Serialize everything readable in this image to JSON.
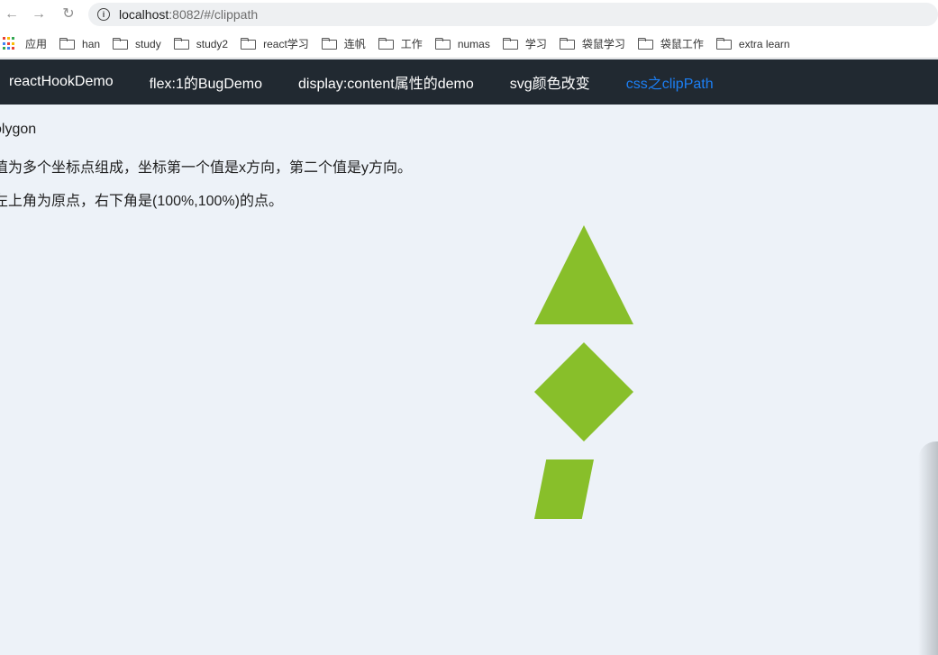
{
  "browser": {
    "url_host": "localhost",
    "url_rest": ":8082/#/clippath",
    "bookmarks": [
      "应用",
      "han",
      "study",
      "study2",
      "react学习",
      "连帆",
      "工作",
      "numas",
      "学习",
      "袋鼠学习",
      "袋鼠工作",
      "extra learn"
    ]
  },
  "nav": {
    "items": [
      "reactHookDemo",
      "flex:1的BugDemo",
      "display:content属性的demo",
      "svg颜色改变",
      "css之clipPath"
    ],
    "active_index": 4
  },
  "content": {
    "lines": [
      "olygon",
      "值为多个坐标点组成，坐标第一个值是x方向，第二个值是y方向。",
      "左上角为原点，右下角是(100%,100%)的点。"
    ],
    "shapes": [
      "triangle",
      "diamond",
      "parallelogram"
    ]
  },
  "colors": {
    "shape_fill": "#88bf2a",
    "nav_bg": "#212931",
    "nav_active": "#1c7ff4",
    "page_bg": "#edf2f8"
  },
  "icons": [
    "back-icon",
    "forward-icon",
    "reload-icon",
    "info-icon",
    "apps-icon",
    "folder-icon"
  ]
}
